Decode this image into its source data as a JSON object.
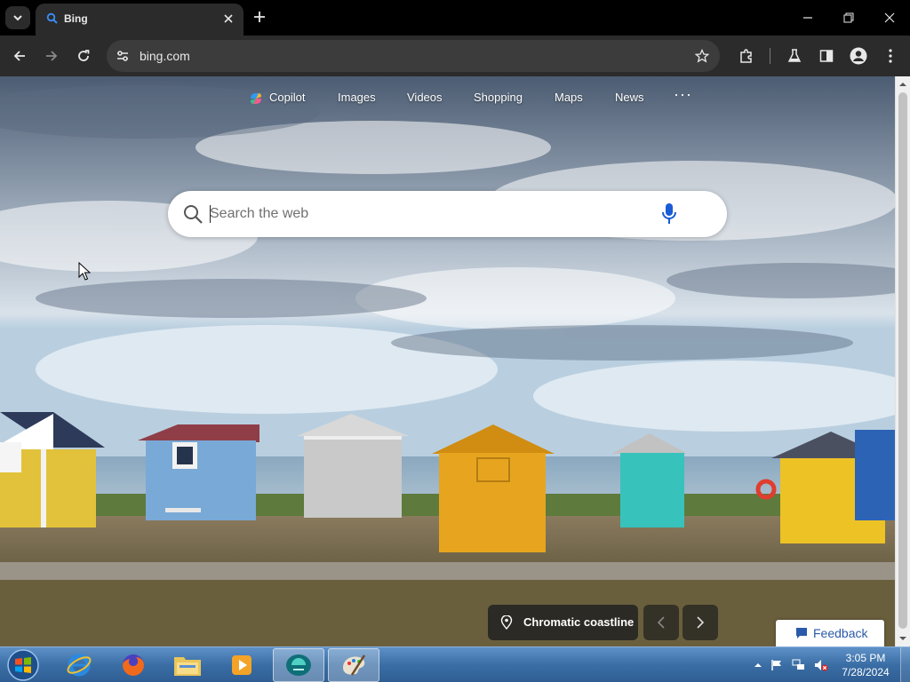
{
  "browser": {
    "tab": {
      "title": "Bing",
      "favicon": "bing-search-icon"
    },
    "address_bar": {
      "url": "bing.com"
    },
    "colors": {
      "chrome_bg": "#000000",
      "toolbar_bg": "#2b2b2b",
      "omnibox_bg": "#3c3c3c"
    }
  },
  "bing": {
    "nav": {
      "copilot": "Copilot",
      "images": "Images",
      "videos": "Videos",
      "shopping": "Shopping",
      "maps": "Maps",
      "news": "News",
      "more": "···"
    },
    "search": {
      "placeholder": "Search the web",
      "value": ""
    },
    "image_caption": "Chromatic coastline",
    "feedback": "Feedback",
    "colors": {
      "feedback_text": "#2a5aa9",
      "mic_blue": "#1a5bd6"
    }
  },
  "taskbar": {
    "apps": [
      "windows-start",
      "internet-explorer",
      "firefox",
      "file-explorer",
      "media-player",
      "bing-app",
      "paint"
    ],
    "clock": {
      "time": "3:05 PM",
      "date": "7/28/2024"
    }
  }
}
